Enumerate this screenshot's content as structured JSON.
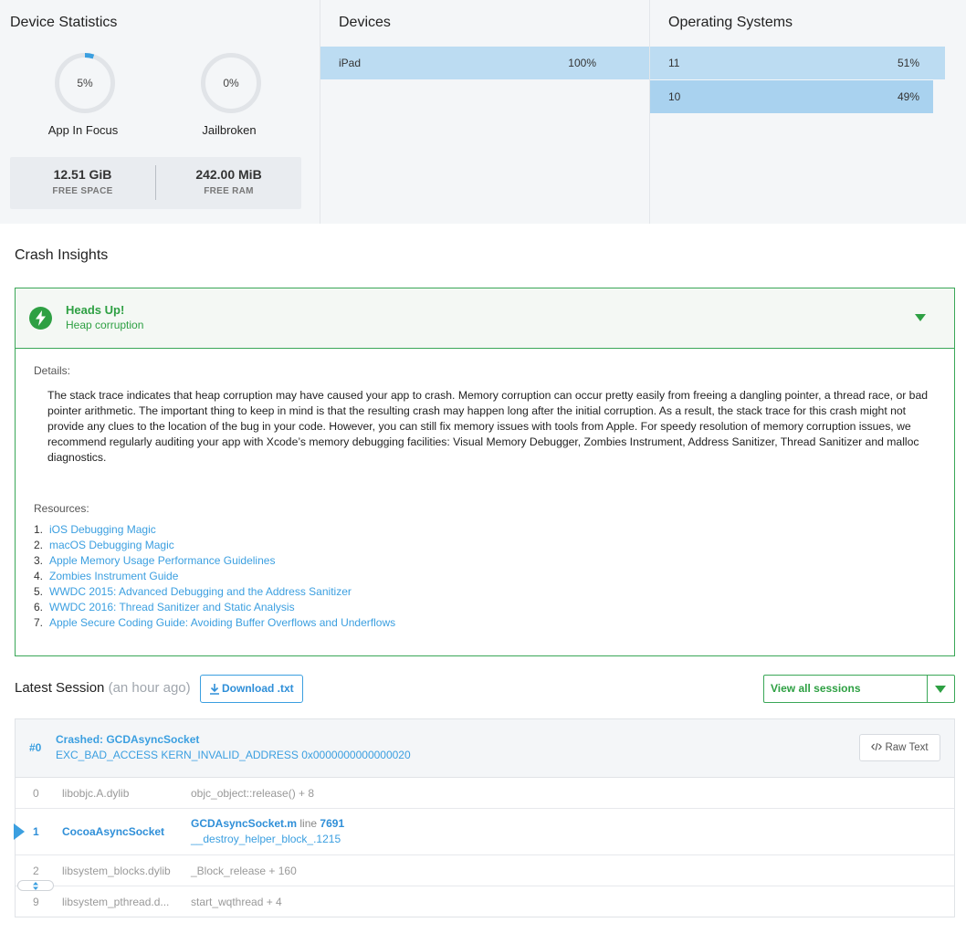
{
  "device_stats": {
    "title": "Device Statistics",
    "app_in_focus": {
      "value": "5%",
      "label": "App In Focus",
      "fraction": 0.05
    },
    "jailbroken": {
      "value": "0%",
      "label": "Jailbroken",
      "fraction": 0.0
    },
    "free_space": {
      "value": "12.51 GiB",
      "label": "FREE SPACE"
    },
    "free_ram": {
      "value": "242.00 MiB",
      "label": "FREE RAM"
    },
    "accent_color": "#3b9fe0"
  },
  "devices": {
    "title": "Devices",
    "rows": [
      {
        "label": "iPad",
        "percent": "100%",
        "fraction": 1.0
      }
    ]
  },
  "operating_systems": {
    "title": "Operating Systems",
    "rows": [
      {
        "label": "11",
        "percent": "51%",
        "fraction": 0.51
      },
      {
        "label": "10",
        "percent": "49%",
        "fraction": 0.49
      }
    ]
  },
  "crash_insights": {
    "title": "Crash Insights",
    "card": {
      "icon": "lightning-bolt-icon",
      "heading": "Heads Up!",
      "subheading": "Heap corruption",
      "details_label": "Details:",
      "details_text": "The stack trace indicates that heap corruption may have caused your app to crash. Memory corruption can occur pretty easily from freeing a dangling pointer, a thread race, or bad pointer arithmetic. The important thing to keep in mind is that the resulting crash may happen long after the initial corruption. As a result, the stack trace for this crash might not provide any clues to the location of the bug in your code. However, you can still fix memory issues with tools from Apple. For speedy resolution of memory corruption issues, we recommend regularly auditing your app with Xcode’s memory debugging facilities: Visual Memory Debugger, Zombies Instrument, Address Sanitizer, Thread Sanitizer and malloc diagnostics.",
      "resources_label": "Resources:",
      "resources": [
        {
          "num": "1.",
          "title": "iOS Debugging Magic"
        },
        {
          "num": "2.",
          "title": "macOS Debugging Magic"
        },
        {
          "num": "3.",
          "title": "Apple Memory Usage Performance Guidelines"
        },
        {
          "num": "4.",
          "title": "Zombies Instrument Guide"
        },
        {
          "num": "5.",
          "title": "WWDC 2015: Advanced Debugging and the Address Sanitizer"
        },
        {
          "num": "6.",
          "title": "WWDC 2016: Thread Sanitizer and Static Analysis"
        },
        {
          "num": "7.",
          "title": "Apple Secure Coding Guide: Avoiding Buffer Overflows and Underflows"
        }
      ],
      "accent_color": "#2ea043"
    }
  },
  "latest_session": {
    "title": "Latest Session",
    "ago": "(an hour ago)",
    "download_label": "Download .txt",
    "view_all_label": "View all sessions",
    "thread": {
      "index": "#0",
      "title": "Crashed: GCDAsyncSocket",
      "exception": "EXC_BAD_ACCESS KERN_INVALID_ADDRESS 0x0000000000000020",
      "raw_text_label": "Raw Text"
    },
    "frames": [
      {
        "num": "0",
        "lib": "libobjc.A.dylib",
        "symbol": "objc_object::release() + 8"
      },
      {
        "num": "1",
        "lib": "CocoaAsyncSocket",
        "file": "GCDAsyncSocket.m",
        "line_label": "line",
        "line": "7691",
        "symbol": "__destroy_helper_block_.1215"
      },
      {
        "num": "2",
        "lib": "libsystem_blocks.dylib",
        "symbol": "_Block_release + 160"
      },
      {
        "num": "9",
        "lib": "libsystem_pthread.d...",
        "symbol": "start_wqthread + 4"
      }
    ]
  }
}
